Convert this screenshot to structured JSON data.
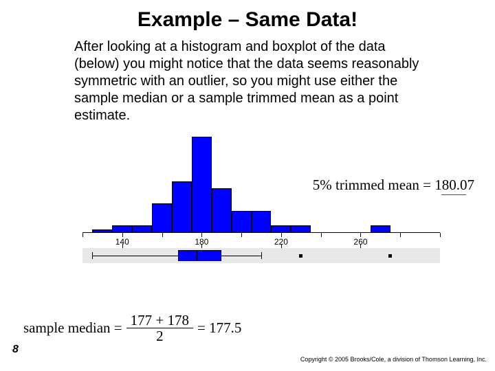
{
  "title": "Example – Same Data!",
  "body": "After looking at a histogram and boxplot of the data (below) you might notice that the data seems reasonably symmetric with an outlier, so you might use either the sample median or a sample trimmed mean as a point estimate.",
  "trimmed_mean_label": "5% trimmed mean = 180.07",
  "median_formula": {
    "lhs": "sample median =",
    "numerator": "177 + 178",
    "denominator": "2",
    "rhs": "= 177.5"
  },
  "page_number": "8",
  "copyright": "Copyright © 2005 Brooks/Cole, a division of Thomson Learning, Inc.",
  "chart_data": {
    "type": "bar",
    "title": "",
    "xlabel": "",
    "ylabel": "",
    "xlim": [
      120,
      300
    ],
    "categories": [
      130,
      140,
      150,
      160,
      170,
      180,
      190,
      200,
      210,
      220,
      230,
      270
    ],
    "values": [
      0.5,
      1,
      1,
      4,
      7,
      13,
      6,
      3,
      3,
      1,
      1,
      1
    ],
    "tick_positions": [
      140,
      180,
      220,
      260
    ],
    "boxplot": {
      "whisker_low": 125,
      "q1": 168,
      "median": 177.5,
      "q3": 190,
      "whisker_high": 210,
      "outliers": [
        230,
        275
      ]
    }
  }
}
